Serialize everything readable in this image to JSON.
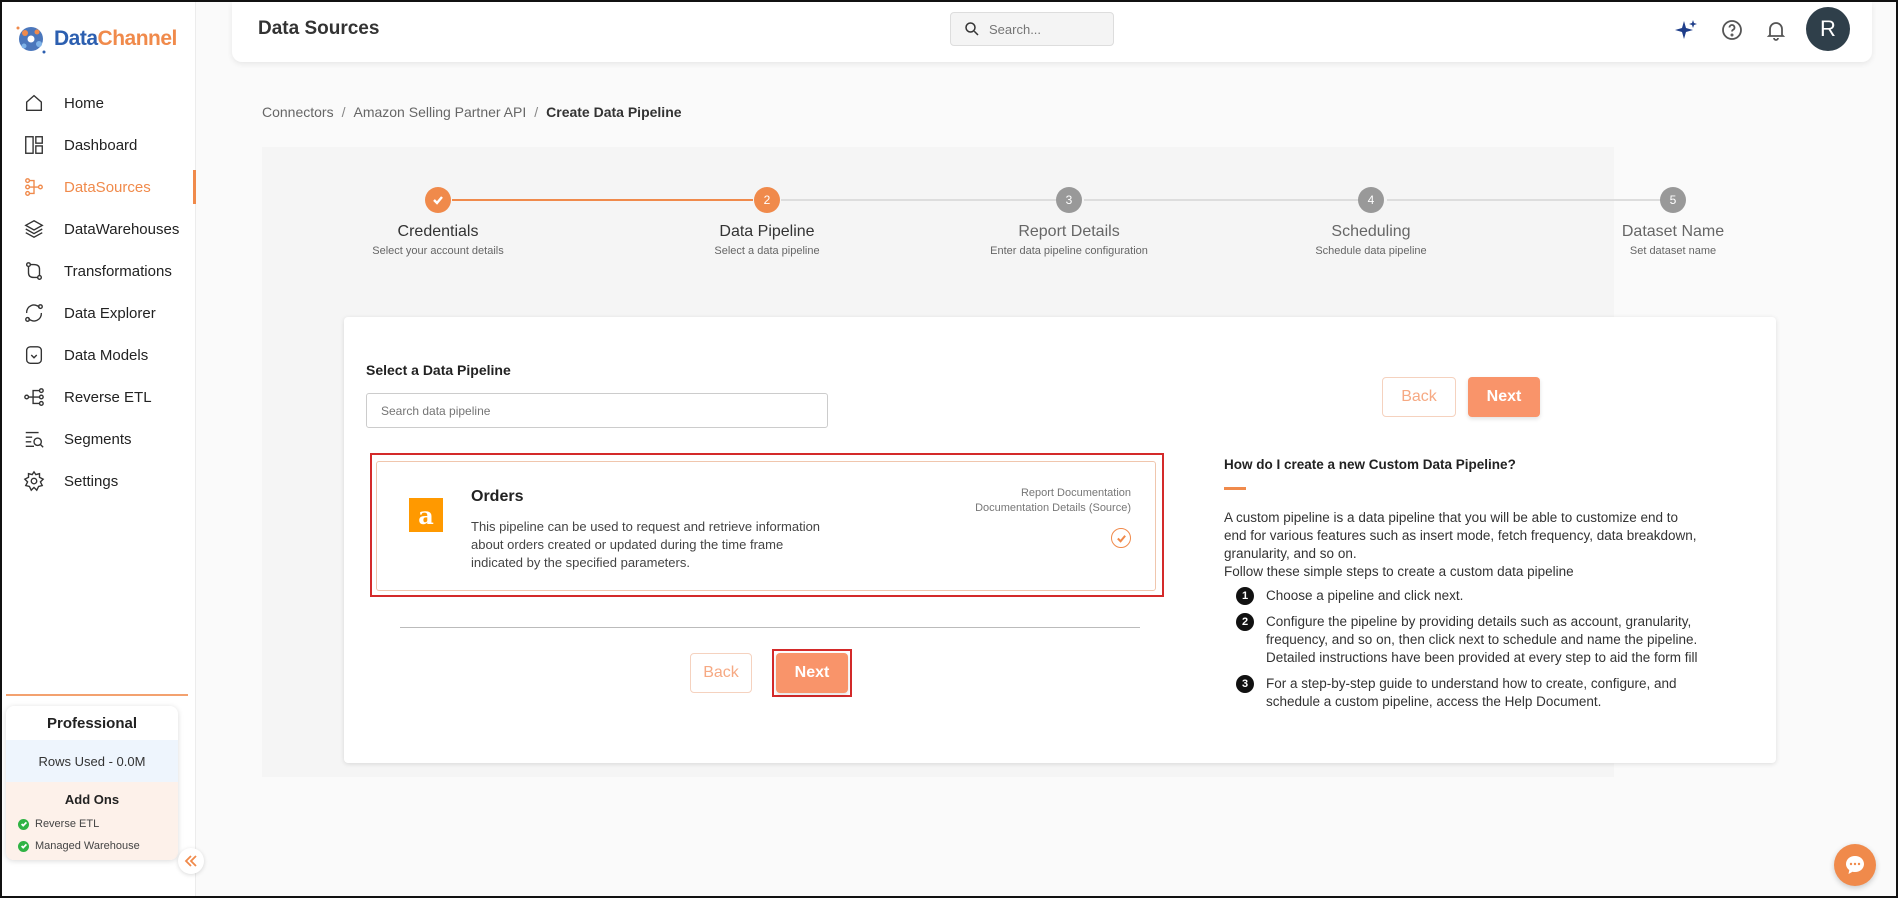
{
  "logo": {
    "part1": "Data",
    "part2": "Channel"
  },
  "sidebar": {
    "items": [
      {
        "label": "Home",
        "icon": "home-icon"
      },
      {
        "label": "Dashboard",
        "icon": "dashboard-icon"
      },
      {
        "label": "DataSources",
        "icon": "datasources-icon",
        "active": true
      },
      {
        "label": "DataWarehouses",
        "icon": "layers-icon"
      },
      {
        "label": "Transformations",
        "icon": "transform-icon"
      },
      {
        "label": "Data Explorer",
        "icon": "explorer-icon"
      },
      {
        "label": "Data Models",
        "icon": "model-icon"
      },
      {
        "label": "Reverse ETL",
        "icon": "reverse-etl-icon"
      },
      {
        "label": "Segments",
        "icon": "segments-icon"
      },
      {
        "label": "Settings",
        "icon": "gear-icon"
      }
    ],
    "plan": {
      "name": "Professional",
      "rows_used": "Rows Used - 0.0M",
      "addons_title": "Add Ons",
      "addons": [
        "Reverse ETL",
        "Managed Warehouse"
      ]
    }
  },
  "header": {
    "title": "Data Sources",
    "search_placeholder": "Search...",
    "avatar_initial": "R"
  },
  "breadcrumb": {
    "items": [
      "Connectors",
      "Amazon Selling Partner API",
      "Create Data Pipeline"
    ],
    "separator": "/"
  },
  "steps": [
    {
      "num": "1",
      "title": "Credentials",
      "subtitle": "Select your account details",
      "state": "done"
    },
    {
      "num": "2",
      "title": "Data Pipeline",
      "subtitle": "Select a data pipeline",
      "state": "active"
    },
    {
      "num": "3",
      "title": "Report Details",
      "subtitle": "Enter data pipeline configuration",
      "state": "pending"
    },
    {
      "num": "4",
      "title": "Scheduling",
      "subtitle": "Schedule data pipeline",
      "state": "pending"
    },
    {
      "num": "5",
      "title": "Dataset Name",
      "subtitle": "Set dataset name",
      "state": "pending"
    }
  ],
  "pipeline": {
    "select_label": "Select a Data Pipeline",
    "search_placeholder": "Search data pipeline",
    "card": {
      "logo_glyph": "a",
      "title": "Orders",
      "description": "This pipeline can be used to request and retrieve information about orders created or updated during the time frame indicated by the specified parameters.",
      "link1": "Report Documentation",
      "link2": "Documentation Details (Source)"
    },
    "back_label": "Back",
    "next_label": "Next"
  },
  "help": {
    "title": "How do I create a new Custom Data Pipeline?",
    "text1": "A custom pipeline is a data pipeline that you will be able to customize end to end for various features such as insert mode, fetch frequency, data breakdown, granularity, and so on.",
    "text2": "Follow these simple steps to create a custom data pipeline",
    "steps": [
      {
        "n": "1",
        "text": "Choose a pipeline and click next."
      },
      {
        "n": "2",
        "text": "Configure the pipeline by providing details such as account, granularity, frequency, and so on, then click next to schedule and name the pipeline. Detailed instructions have been provided at every step to aid the form fill"
      },
      {
        "n": "3",
        "text": "For a step-by-step guide to understand how to create, configure, and schedule a custom pipeline, access the Help Document."
      }
    ]
  },
  "colors": {
    "accent": "#f08a4b",
    "brand_blue": "#2c5fb0",
    "highlight_red": "#d42a2a",
    "avatar_bg": "#2f3f4a"
  }
}
